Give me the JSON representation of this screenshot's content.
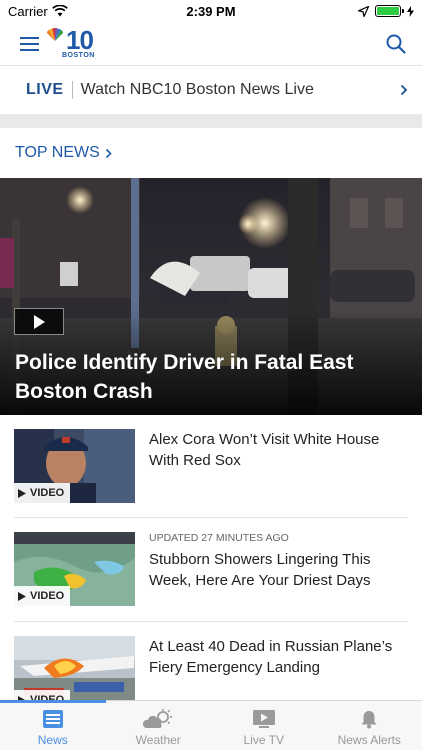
{
  "status_bar": {
    "carrier": "Carrier",
    "time": "2:39 PM"
  },
  "header": {
    "logo_number": "10",
    "logo_city": "BOSTON"
  },
  "live": {
    "tag": "LIVE",
    "text": "Watch NBC10 Boston News Live"
  },
  "section": {
    "title": "TOP NEWS"
  },
  "hero": {
    "title": "Police Identify Driver in Fatal East Boston Crash"
  },
  "stories": [
    {
      "title": "Alex Cora Won’t Visit White House With Red Sox",
      "badge": "VIDEO",
      "updated": ""
    },
    {
      "title": "Stubborn Showers Lingering This Week, Here Are Your Driest Days",
      "badge": "VIDEO",
      "updated": "UPDATED 27 MINUTES AGO"
    },
    {
      "title": "At Least 40 Dead in Russian Plane’s Fiery Emergency Landing",
      "badge": "VIDEO",
      "updated": ""
    }
  ],
  "tabs": [
    {
      "label": "News",
      "icon": "news-icon",
      "active": true
    },
    {
      "label": "Weather",
      "icon": "weather-icon",
      "active": false
    },
    {
      "label": "Live TV",
      "icon": "live-tv-icon",
      "active": false
    },
    {
      "label": "News Alerts",
      "icon": "bell-icon",
      "active": false
    }
  ],
  "colors": {
    "brand_blue": "#1e5aa8",
    "tab_active": "#4a90e2",
    "battery_green": "#2ecc40"
  },
  "battery_level": 1.0
}
